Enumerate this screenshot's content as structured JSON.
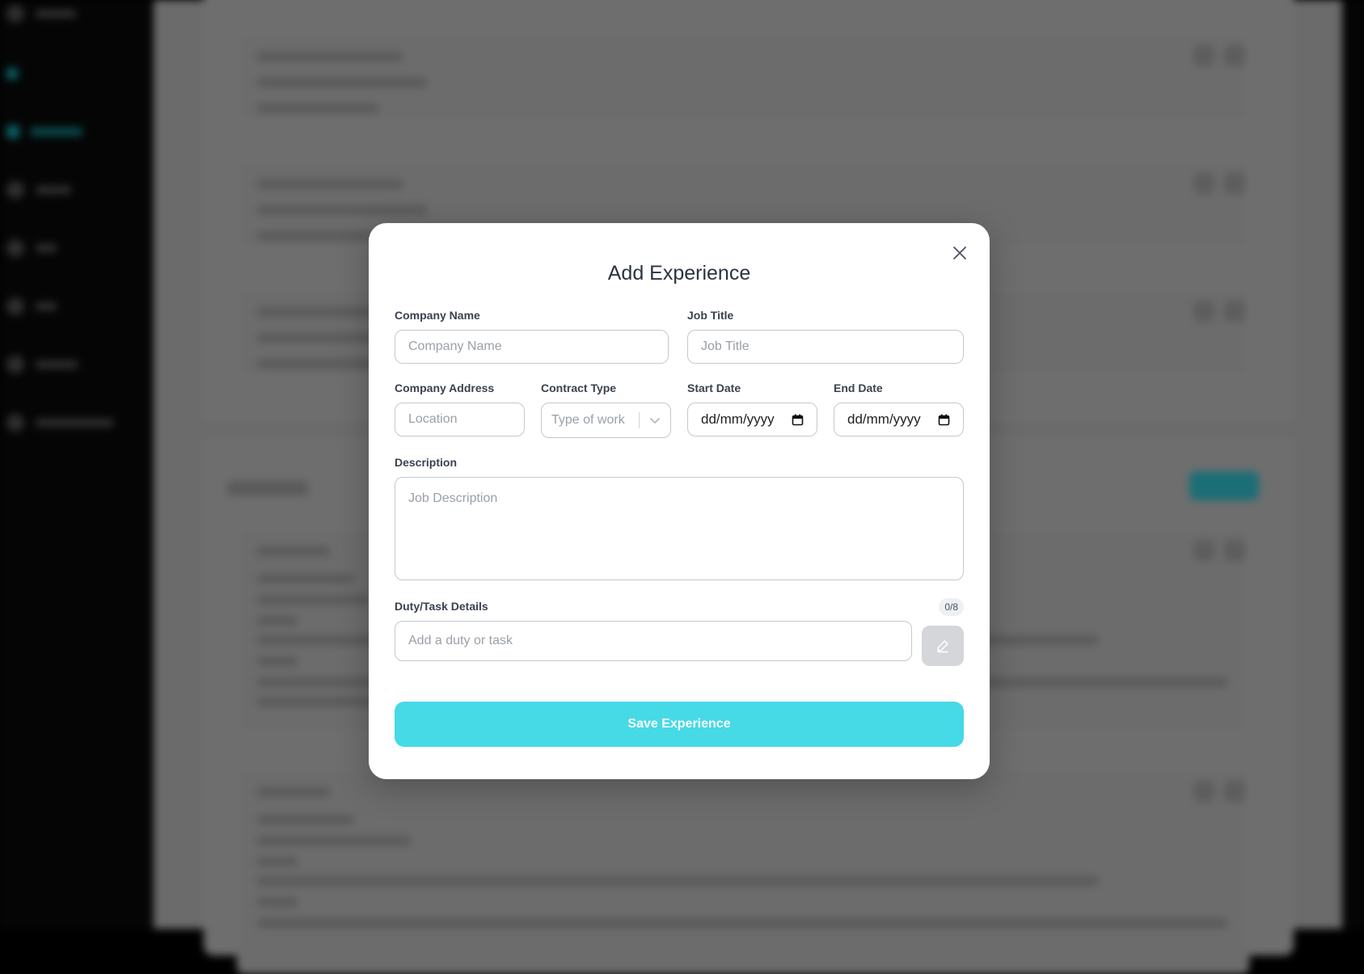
{
  "modal": {
    "title": "Add Experience",
    "fields": {
      "company_name": {
        "label": "Company Name",
        "placeholder": "Company Name"
      },
      "job_title": {
        "label": "Job Title",
        "placeholder": "Job Title"
      },
      "company_address": {
        "label": "Company Address",
        "placeholder": "Location"
      },
      "contract_type": {
        "label": "Contract Type",
        "placeholder": "Type of work"
      },
      "start_date": {
        "label": "Start Date",
        "value": "dd/mm/yyyy"
      },
      "end_date": {
        "label": "End Date",
        "value": "dd/mm/yyyy"
      },
      "description": {
        "label": "Description",
        "placeholder": "Job Description"
      },
      "duties": {
        "label": "Duty/Task Details",
        "placeholder": "Add a duty or task",
        "counter": "0/8"
      }
    },
    "save_label": "Save Experience",
    "icons": {
      "close": "close-icon",
      "chevron": "chevron-down-icon",
      "calendar": "calendar-icon",
      "add": "edit-icon"
    },
    "colors": {
      "accent": "#46d9e6",
      "title": "#2c3341",
      "disabled_button": "#d4d6da"
    }
  }
}
